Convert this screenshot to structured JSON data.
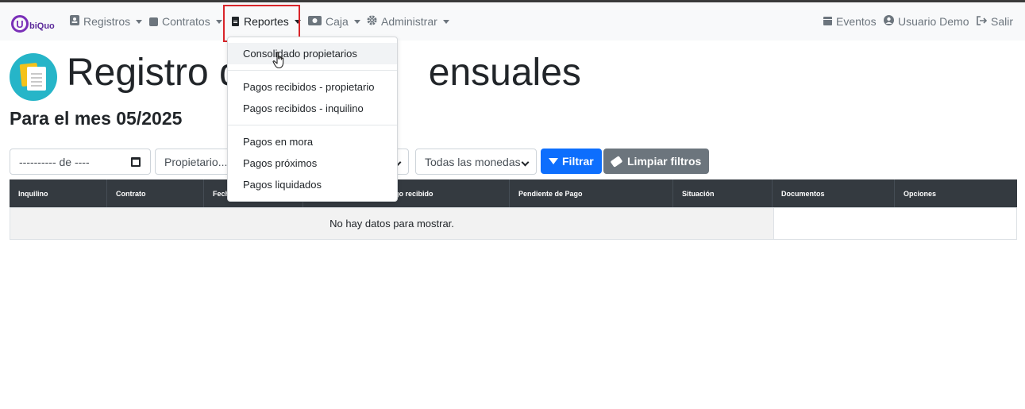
{
  "brand": {
    "letter": "U",
    "text": "biQuo"
  },
  "nav": {
    "registros": "Registros",
    "contratos": "Contratos",
    "reportes": "Reportes",
    "caja": "Caja",
    "administrar": "Administrar",
    "eventos": "Eventos",
    "usuario": "Usuario Demo",
    "salir": "Salir"
  },
  "icons": {
    "registros": "id-card-icon",
    "contratos": "square-icon",
    "reportes": "file-icon",
    "caja": "money-icon",
    "administrar": "gear-icon",
    "eventos": "calendar-icon",
    "usuario": "user-icon",
    "salir": "sign-out-icon"
  },
  "page": {
    "title_left": "Registro d",
    "title_right": "ensuales",
    "subtitle": "Para el mes 05/2025"
  },
  "filters": {
    "month_placeholder": "---------- de ----",
    "propietario": "Propietario...",
    "moneda": "Todas las monedas",
    "filtrar": "Filtrar",
    "limpiar": "Limpiar filtros"
  },
  "table": {
    "headers": [
      "Inquilino",
      "Contrato",
      "Fech",
      "go recibido",
      "Pendiente de Pago",
      "Situación",
      "Documentos",
      "Opciones"
    ],
    "empty_message": "No hay datos para mostrar."
  },
  "dropdown": {
    "items": [
      "Consolidado propietarios",
      "Pagos recibidos - propietario",
      "Pagos recibidos - inquilino",
      "Pagos en mora",
      "Pagos próximos",
      "Pagos liquidados"
    ]
  },
  "colors": {
    "brand": "#7a2fb8",
    "primary": "#0d6efd",
    "secondary": "#6c757d",
    "table_header": "#343a40",
    "highlight": "#d9252a"
  }
}
